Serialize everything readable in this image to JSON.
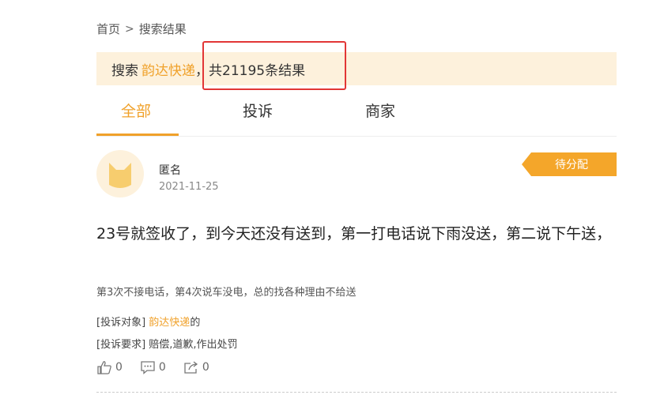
{
  "breadcrumb": {
    "home": "首页",
    "separator": ">",
    "current": "搜索结果"
  },
  "result_bar": {
    "prefix": "搜索",
    "keyword": "韵达快递",
    "summary": "，共21195条结果"
  },
  "tabs": [
    {
      "label": "全部",
      "active": true
    },
    {
      "label": "投诉",
      "active": false
    },
    {
      "label": "商家",
      "active": false
    }
  ],
  "post": {
    "author": "匿名",
    "date": "2021-11-25",
    "status": "待分配",
    "title": "23号就签收了，到今天还没有送到，第一打电话说下雨没送，第二说下午送，",
    "description": "第3次不接电话，第4次说车没电，总的找各种理由不给送",
    "target_label": "[投诉对象]",
    "target_name": "韵达快递",
    "target_suffix": "的",
    "demand_label": "[投诉要求]",
    "demand_value": "赔偿,道歉,作出处罚",
    "likes": "0",
    "comments": "0",
    "shares": "0"
  },
  "colors": {
    "accent": "#f0a12a",
    "highlight": "#e23636",
    "banner_bg": "#fdf1dc"
  },
  "icons": [
    "cat-avatar-icon",
    "thumbs-up-icon",
    "comment-icon",
    "share-icon"
  ]
}
